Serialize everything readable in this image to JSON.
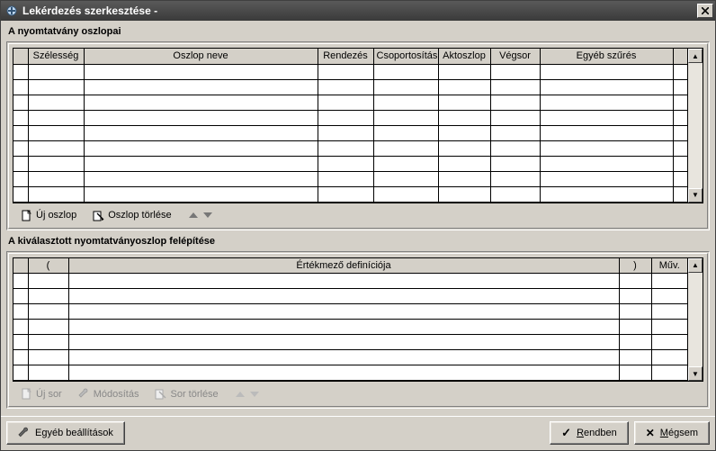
{
  "window": {
    "title": "Lekérdezés szerkesztése -"
  },
  "section1": {
    "label": "A nyomtatvány oszlopai",
    "headers": {
      "rowmark": "",
      "width": "Szélesség",
      "colname": "Oszlop neve",
      "sort": "Rendezés",
      "group": "Csoportosítás",
      "actcol": "Aktoszlop",
      "endrow": "Végsor",
      "filter": "Egyéb szűrés",
      "tail": ""
    },
    "toolbar": {
      "newcol": "Új oszlop",
      "delcol": "Oszlop törlése"
    }
  },
  "section2": {
    "label": "A kiválasztott nyomtatványoszlop felépítése",
    "headers": {
      "rowmark": "",
      "open": "(",
      "def": "Értékmező definíciója",
      "close": ")",
      "op": "Műv."
    },
    "toolbar": {
      "newrow": "Új sor",
      "modify": "Módosítás",
      "delrow": "Sor törlése"
    }
  },
  "footer": {
    "other": "Egyéb beállítások",
    "ok": "Rendben",
    "cancel": "Mégsem"
  }
}
